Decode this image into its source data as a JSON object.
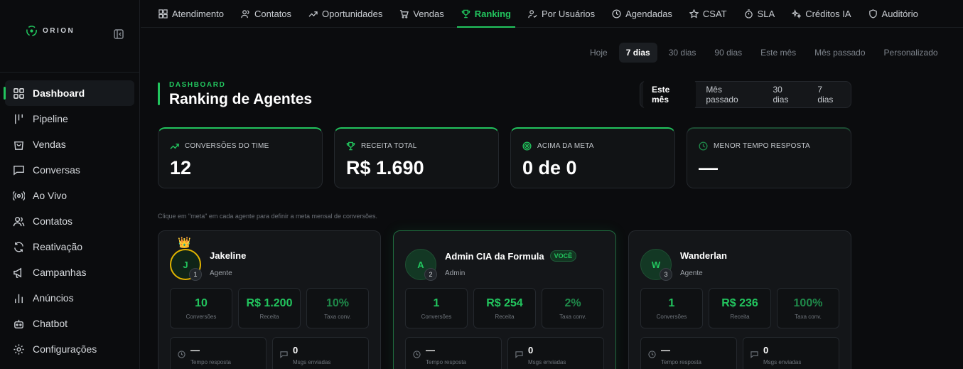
{
  "brand": {
    "name": "ORION"
  },
  "sidebar": {
    "items": [
      {
        "label": "Dashboard",
        "icon": "grid-icon"
      },
      {
        "label": "Pipeline",
        "icon": "columns-icon"
      },
      {
        "label": "Vendas",
        "icon": "bag-icon"
      },
      {
        "label": "Conversas",
        "icon": "chat-icon"
      },
      {
        "label": "Ao Vivo",
        "icon": "broadcast-icon"
      },
      {
        "label": "Contatos",
        "icon": "users-icon"
      },
      {
        "label": "Reativação",
        "icon": "refresh-icon"
      },
      {
        "label": "Campanhas",
        "icon": "megaphone-icon"
      },
      {
        "label": "Anúncios",
        "icon": "bars-icon"
      },
      {
        "label": "Chatbot",
        "icon": "bot-icon"
      },
      {
        "label": "Configurações",
        "icon": "gear-icon"
      }
    ]
  },
  "topnav": {
    "tabs": [
      {
        "label": "Atendimento"
      },
      {
        "label": "Contatos"
      },
      {
        "label": "Oportunidades"
      },
      {
        "label": "Vendas"
      },
      {
        "label": "Ranking"
      },
      {
        "label": "Por Usuários"
      },
      {
        "label": "Agendadas"
      },
      {
        "label": "CSAT"
      },
      {
        "label": "SLA"
      },
      {
        "label": "Créditos IA"
      },
      {
        "label": "Auditório"
      }
    ]
  },
  "period": [
    "Hoje",
    "7 dias",
    "30 dias",
    "90 dias",
    "Este mês",
    "Mês passado",
    "Personalizado"
  ],
  "header": {
    "eyebrow": "DASHBOARD",
    "title": "Ranking de Agentes"
  },
  "segment": [
    "Este mês",
    "Mês passado",
    "30 dias",
    "7 dias"
  ],
  "kpis": [
    {
      "label": "CONVERSÕES DO TIME",
      "value": "12"
    },
    {
      "label": "RECEITA TOTAL",
      "value": "R$ 1.690"
    },
    {
      "label": "ACIMA DA META",
      "value": "0 de 0"
    },
    {
      "label": "MENOR TEMPO RESPOSTA",
      "value": "—"
    }
  ],
  "hint": "Clique em \"meta\" em cada agente para definir a meta mensal de conversões.",
  "agents": [
    {
      "initial": "J",
      "rank": "1",
      "name": "Jakeline",
      "role": "Agente",
      "badge": "",
      "conversions": "10",
      "conversions_label": "Conversões",
      "revenue": "R$ 1.200",
      "revenue_label": "Receita",
      "rate": "10%",
      "rate_label": "Taxa conv.",
      "response": "—",
      "response_label": "Tempo resposta",
      "msgs": "0",
      "msgs_label": "Msgs enviadas"
    },
    {
      "initial": "A",
      "rank": "2",
      "name": "Admin CIA da Formula",
      "role": "Admin",
      "badge": "VOCÊ",
      "conversions": "1",
      "conversions_label": "Conversões",
      "revenue": "R$ 254",
      "revenue_label": "Receita",
      "rate": "2%",
      "rate_label": "Taxa conv.",
      "response": "—",
      "response_label": "Tempo resposta",
      "msgs": "0",
      "msgs_label": "Msgs enviadas"
    },
    {
      "initial": "W",
      "rank": "3",
      "name": "Wanderlan",
      "role": "Agente",
      "badge": "",
      "conversions": "1",
      "conversions_label": "Conversões",
      "revenue": "R$ 236",
      "revenue_label": "Receita",
      "rate": "100%",
      "rate_label": "Taxa conv.",
      "response": "—",
      "response_label": "Tempo resposta",
      "msgs": "0",
      "msgs_label": "Msgs enviadas"
    }
  ],
  "colors": {
    "accent": "#22c55e",
    "background": "#0b0c0e",
    "crown": "#e0b300"
  }
}
